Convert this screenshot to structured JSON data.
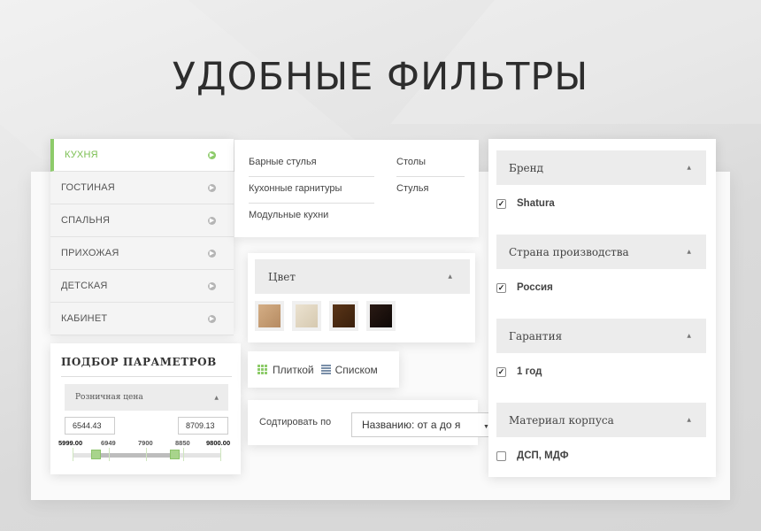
{
  "title": "УДОБНЫЕ ФИЛЬТРЫ",
  "categories": [
    {
      "label": "КУХНЯ",
      "active": true
    },
    {
      "label": "ГОСТИНАЯ",
      "active": false
    },
    {
      "label": "СПАЛЬНЯ",
      "active": false
    },
    {
      "label": "ПРИХОЖАЯ",
      "active": false
    },
    {
      "label": "ДЕТСКАЯ",
      "active": false
    },
    {
      "label": "КАБИНЕТ",
      "active": false
    }
  ],
  "subcategories": {
    "col1": [
      "Барные стулья",
      "Кухонные гарнитуры",
      "Модульные кухни"
    ],
    "col2": [
      "Столы",
      "Стулья"
    ]
  },
  "params": {
    "title": "ПОДБОР ПАРАМЕТРОВ",
    "price_label": "Розничная цена",
    "from_value": "6544.43",
    "to_value": "8709.13",
    "ticks": [
      "5999.00",
      "6949",
      "7900",
      "8850",
      "9800.00"
    ]
  },
  "color_filter": {
    "title": "Цвет",
    "swatches": [
      "#c9a27a",
      "#e3d8c4",
      "#4a2a14",
      "#1c1210"
    ]
  },
  "view": {
    "tiles_label": "Плиткой",
    "list_label": "Списком"
  },
  "sort": {
    "label": "Содтировать по",
    "value": "Названию: от а до я"
  },
  "filters": [
    {
      "title": "Бренд",
      "option": "Shatura",
      "checked": true
    },
    {
      "title": "Страна производства",
      "option": "Россия",
      "checked": true
    },
    {
      "title": "Гарантия",
      "option": "1 год",
      "checked": true
    },
    {
      "title": "Материал корпуса",
      "option": "ДСП, МДФ",
      "checked": false
    }
  ],
  "colors": {
    "accent": "#8dcb6a",
    "header_bg": "#ececec"
  }
}
